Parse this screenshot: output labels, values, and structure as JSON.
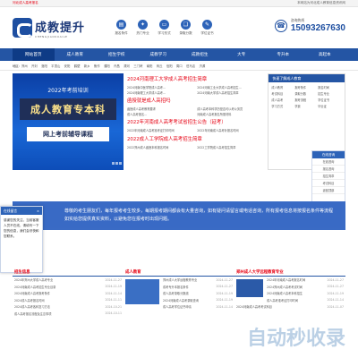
{
  "topbar": {
    "welcome": "河北成人高考报名",
    "right": "本网站为河北成人教育信息资讯网"
  },
  "logo": {
    "cn": "成教提升",
    "en": "CHENGJIAOKUAILE"
  },
  "features": [
    {
      "icon": "doc-icon",
      "glyph": "▤",
      "label": "报名条件"
    },
    {
      "icon": "fire-icon",
      "glyph": "✦",
      "label": "热门专业"
    },
    {
      "icon": "monitor-icon",
      "glyph": "▭",
      "label": "学习形式"
    },
    {
      "icon": "book-icon",
      "glyph": "❏",
      "label": "录取分数"
    },
    {
      "icon": "cap-icon",
      "glyph": "✎",
      "label": "学位证书"
    }
  ],
  "contact": {
    "hotline": "咨询热线",
    "number": "15093267630"
  },
  "nav": [
    "网站首页",
    "成人教育",
    "招生学校",
    "成教学习",
    "成教招生",
    "大专",
    "专升本",
    "高起本"
  ],
  "filter": {
    "label": "地区:",
    "cities": [
      "郑州",
      "开封",
      "洛阳",
      "平顶山",
      "安阳",
      "鹤壁",
      "新乡",
      "焦作",
      "濮阳",
      "许昌",
      "漯河",
      "三门峡",
      "南阳",
      "商丘",
      "信阳",
      "周口",
      "驻马店",
      "济源"
    ]
  },
  "banner": {
    "line1": "2022年考前培训",
    "line2": "成人教育专本科",
    "line3": "网上考前辅导课程"
  },
  "news": {
    "head1": "2024河南理工大学成人高考招生简章",
    "rows1": [
      [
        "2024河南中医学院成人高考...",
        "2024河南工业大学成人高考招生..."
      ],
      [
        "2024河南理工大学成人高考...",
        "2024河南大学成人高考招生简章"
      ]
    ],
    "head2": "函授就是成人高招吗",
    "rows2": [
      [
        "函授成人高考教育要求",
        "成人高考本科学历是否可以考公务员"
      ],
      [
        "成人高考报名...",
        "河南成人高考报名所需材料"
      ]
    ],
    "head3": "2022年河南成人高考考试省招生公告（延考）",
    "rows3": [
      [
        "2022年河南成人高考准考证打印时间",
        "2022年河南成人高考补报名时间"
      ]
    ],
    "head4": "2022成人工学院成人高考招生简章",
    "rows4": [
      [
        "2022郑州成人函授本科报名时间",
        "2022工学院成人高考招生简章"
      ]
    ]
  },
  "sidebar": {
    "title": "快速了解成人教育",
    "items": [
      "成人教育",
      "报考条件",
      "报名时间",
      "考试科目",
      "录取分数",
      "招生专业",
      "成人高考",
      "报考流程",
      "学位证书",
      "学习方式",
      "学费",
      "毕业证"
    ]
  },
  "float": {
    "title": "在线咨询",
    "items": [
      "在线咨询",
      "报名咨询",
      "招生简章",
      "考试科目",
      "返回顶部"
    ]
  },
  "notice": {
    "text": "尊敬的考生朋友们，每年报考考生较多，每期报考期间都会有大量咨询，如有疑问请留言或电话咨询，所有报考信息将按报名条件等流程如实给您提供真实资料，以避免您在报考时出现问题。"
  },
  "chat": {
    "title": "在线留言",
    "close": "×",
    "body": "感谢您的关注，当前客服人员不在线，请填写一下您的信息，我们会尽快和您联系。"
  },
  "lower": {
    "col1": {
      "title": "招生信息",
      "rows": [
        [
          "2024年郑州大学成人高考专业",
          "2024-11-27"
        ],
        [
          "2024河南成人高考招生专业目录",
          "2024-11-19"
        ],
        [
          "2024河南成人高考报考条件",
          "2024-11-14"
        ],
        [
          "2024成人高考报名时间",
          "2024-11-11"
        ],
        [
          "2024成人高考各科复习方法",
          "2024-10-21"
        ],
        [
          "成人高考报名流程及注意事项",
          "2024-10-11"
        ]
      ]
    },
    "col2": {
      "title": "成人教育",
      "rows": [
        [
          "郑州成人大学远程教育专业",
          "2024-11-27"
        ],
        [
          "成考专升本报名条件",
          "2024-11-27"
        ],
        [
          "成人高考录取分数线",
          "2024-11-19"
        ],
        [
          "2024河南成人高考录取查询",
          "2024-11-19"
        ],
        [
          "成人高考学位证书申请",
          "2024-11-14"
        ]
      ]
    },
    "col3": {
      "title": "郑州成人大学远程教育专业",
      "rows": [
        [
          "2024年河南成人高考报名时间",
          "2024-11-27"
        ],
        [
          "2024郑州成人高考考试时间",
          "2024-11-27"
        ],
        [
          "2024河南成人高考本科招生",
          "2024-11-19"
        ],
        [
          "成人高考准考证打印时间",
          "2024-11-14"
        ],
        [
          "2024河南成人高考考试科目",
          "2024-11-07"
        ]
      ]
    }
  },
  "watermark": "自动秒收录"
}
